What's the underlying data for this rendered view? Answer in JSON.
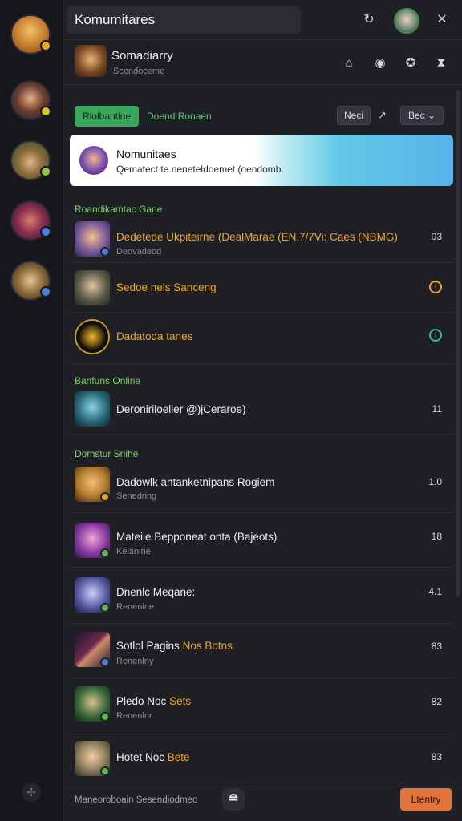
{
  "rail": {
    "avatars": [
      {
        "name": "hero-1",
        "badge_color": "#e8a42a"
      },
      {
        "name": "hero-2",
        "badge_color": "#d7c42a"
      },
      {
        "name": "hero-3",
        "badge_color": "#8fc34a"
      },
      {
        "name": "hero-4",
        "badge_color": "#4a7fd8"
      },
      {
        "name": "hero-5",
        "badge_color": "#4a7fd8"
      }
    ],
    "bottom_icon": "settings-icon"
  },
  "header": {
    "title": "Komumitares",
    "refresh_icon": "↻",
    "close_icon": "✕"
  },
  "profile": {
    "name": "Somadiarry",
    "subtitle": "Scendoceme",
    "nav_icons": [
      "⌂",
      "◉",
      "✪",
      "⧗"
    ]
  },
  "filters": {
    "green_pill": "Rioibantine",
    "green_link": "Doend Ronaen",
    "next_button": "Neci",
    "arrow": "↗",
    "sort_button": "Bec ⌄"
  },
  "banner": {
    "title": "Nomunitaes",
    "description": "Qematect te neneteldoemet (oendomb."
  },
  "sections": {
    "s1": "Roandikamtac Gane",
    "s2": "Banfuns Online",
    "s3": "Domstur Sriihe"
  },
  "rows": [
    {
      "title": "Dedetede Ukpiteirne (DealMarae (EN.7/7Vi: Caes (NBMG)",
      "sub": "Deovadeod",
      "count": "03",
      "orange": true
    },
    {
      "title": "Sedoe nels Sanceng",
      "sub": "",
      "count": "",
      "ring": "orange",
      "orange": true
    },
    {
      "title": "Dadatoda tanes",
      "sub": "",
      "count": "",
      "ring": "teal",
      "orange": true
    },
    {
      "title": "Deroniriloelier @)jCeraroe)",
      "sub": "",
      "count": "11"
    },
    {
      "title": "Dadowlk antanketnipans Rogiem",
      "sub": "Senedring",
      "count": "1.0"
    },
    {
      "title": "Mateiie Bepponeat onta (Bajeots)",
      "sub": "Kelanine",
      "count": "18"
    },
    {
      "title": "Dnenlc Meqane:",
      "sub": "Renenine",
      "count": "4.1"
    },
    {
      "title": "Sotlol Pagins",
      "title_hl": "Nos Botns",
      "sub": "Renenlny",
      "count": "83"
    },
    {
      "title": "Pledo Noc",
      "title_hl": "Sets",
      "sub": "Renenlnr",
      "count": "82"
    },
    {
      "title": "Hotet Noc",
      "title_hl": "Bete",
      "sub": "",
      "count": "83"
    }
  ],
  "footer": {
    "text": "Maneoroboain Sesendiodmeo",
    "mid_icon": "≘",
    "cta": "Ltentry"
  },
  "colors": {
    "accent_green": "#3aa65a",
    "accent_orange": "#f0a531",
    "cta_orange": "#e0743a",
    "teal": "#3fb8a6"
  }
}
